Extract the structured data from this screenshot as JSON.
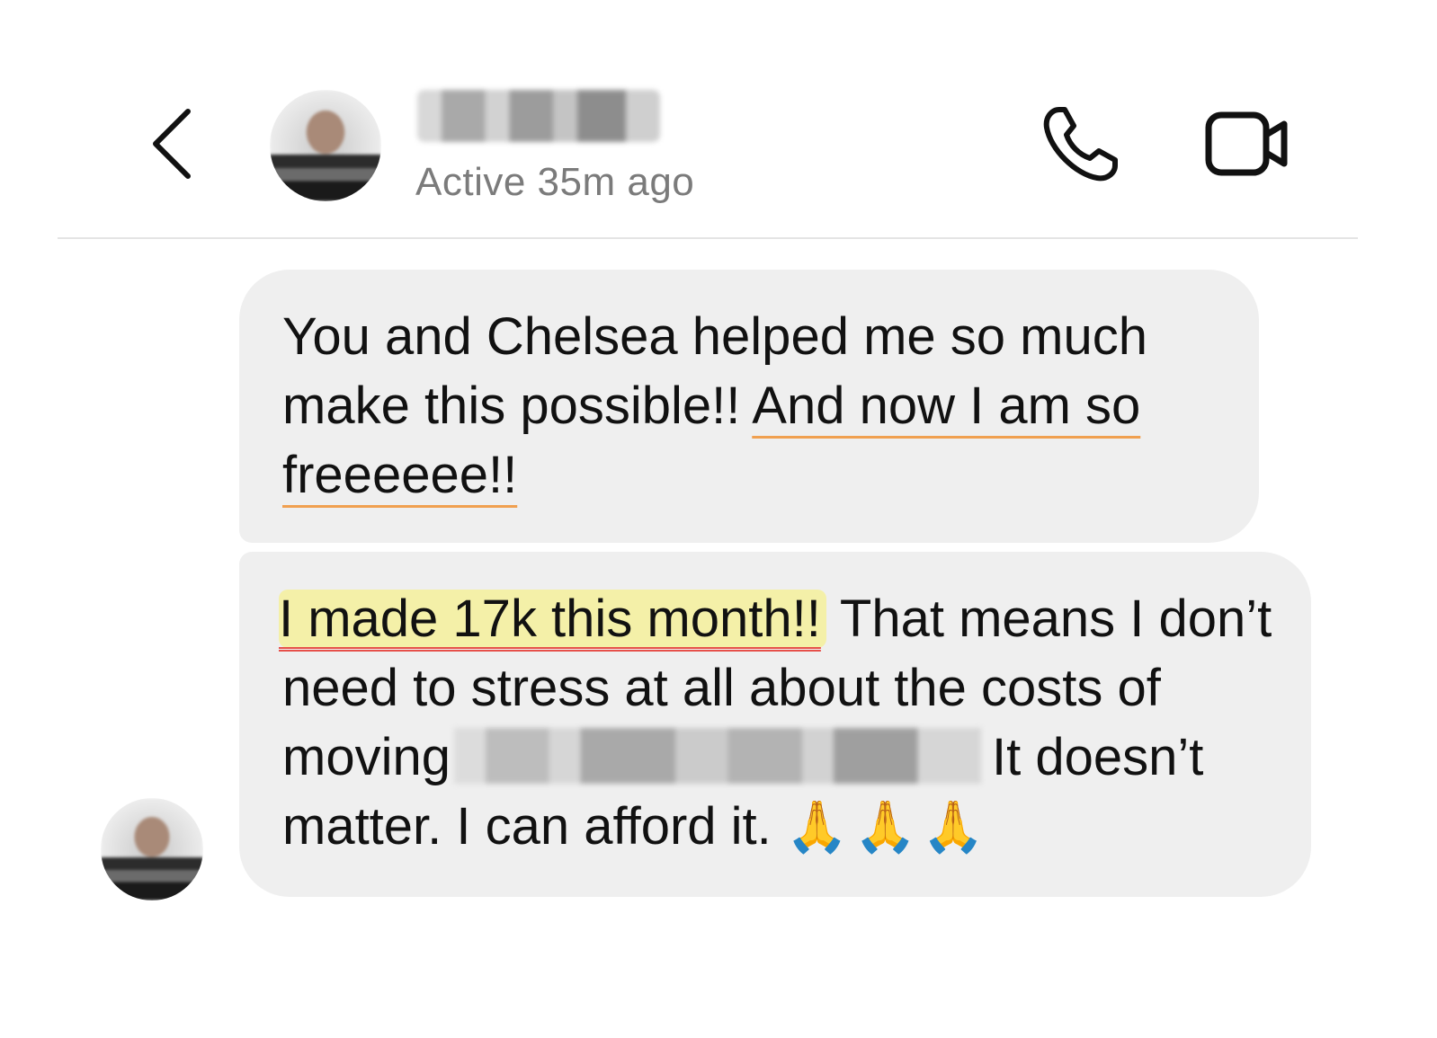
{
  "header": {
    "contact_name": "",
    "status": "Active 35m ago",
    "icons": {
      "back": "chevron-left-icon",
      "call": "phone-icon",
      "video": "video-camera-icon"
    }
  },
  "messages": [
    {
      "parts": {
        "text_a": "You and Chelsea helped me so much make this possible!! ",
        "text_b": "And now I am so freeeeee!!"
      }
    },
    {
      "parts": {
        "highlight": "I made 17k this month!!",
        "text_a": " That means I don’t need to stress at all about the costs of moving",
        "redacted": "",
        "text_b": "It doesn’t matter. I can afford it.",
        "emoji": "🙏🙏🙏"
      }
    }
  ],
  "colors": {
    "bubble_bg": "#efefef",
    "status_text": "#7b7b7b",
    "highlight_bg": "#f4f0a8",
    "underline_orange": "#f0a050",
    "underline_red": "#e6504a"
  }
}
